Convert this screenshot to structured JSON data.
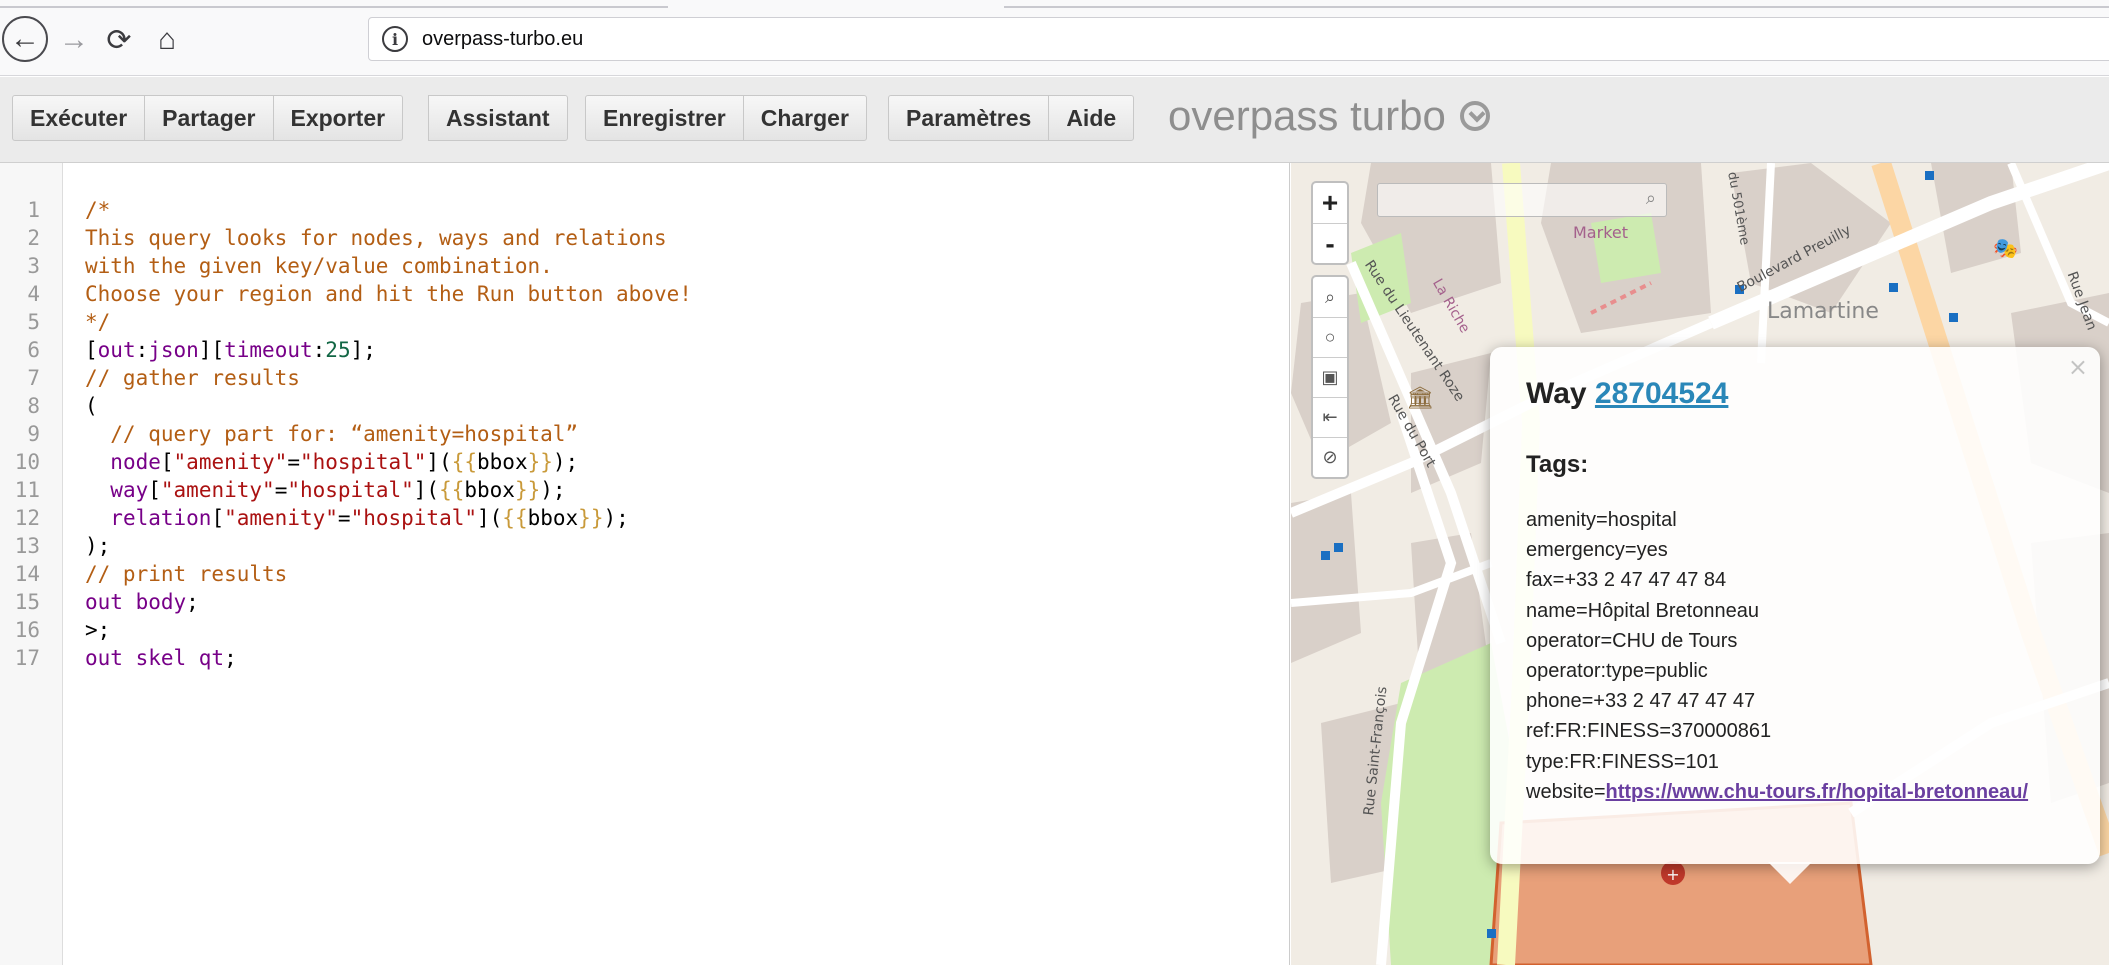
{
  "browser": {
    "url": "overpass-turbo.eu",
    "icons": {
      "back": "back-arrow-icon",
      "forward": "forward-arrow-icon",
      "reload": "reload-icon",
      "home": "home-icon",
      "info": "info-icon"
    }
  },
  "toolbar": {
    "run": "Exécuter",
    "share": "Partager",
    "export": "Exporter",
    "wizard": "Assistant",
    "save": "Enregistrer",
    "load": "Charger",
    "settings": "Paramètres",
    "help": "Aide",
    "brand": "overpass turbo"
  },
  "editor": {
    "line_numbers": [
      "1",
      "2",
      "3",
      "4",
      "5",
      "6",
      "7",
      "8",
      "9",
      "10",
      "11",
      "12",
      "13",
      "14",
      "15",
      "16",
      "17"
    ]
  },
  "map": {
    "zoom_in": "+",
    "zoom_out": "-",
    "labels": {
      "market": "Market",
      "lamartine": "Lamartine",
      "boulevard_preuilly": "Boulevard Preuilly",
      "rue_lieutenant_roze": "Rue du Lieutenant Roze",
      "rue_du_port": "Rue du Port",
      "rue_saint_francois": "Rue Saint-François",
      "la_riche": "La Riche",
      "du_501e": "du 501ème",
      "rue_jean": "Rue Jean"
    }
  },
  "popup": {
    "close": "×",
    "title_prefix": "Way",
    "way_id": "28704524",
    "tags_heading": "Tags:",
    "tags": [
      "amenity=hospital",
      "emergency=yes",
      "fax=+33 2 47 47 47 84",
      "name=Hôpital Bretonneau",
      "operator=CHU de Tours",
      "operator:type=public",
      "phone=+33 2 47 47 47 47",
      "ref:FR:FINESS=370000861",
      "type:FR:FINESS=101"
    ],
    "website_key": "website=",
    "website_url": "https://www.chu-tours.fr/hopital-bretonneau/"
  },
  "colors": {
    "toolbar_bg": "#ebebeb",
    "brand_gray": "#8e8e8e",
    "comment": "#b35e14",
    "string": "#aa1111",
    "keyword": "#770088",
    "link": "#2a87b8",
    "hospital_area": "#e8a07a"
  }
}
